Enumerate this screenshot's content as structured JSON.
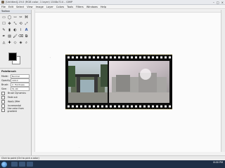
{
  "window": {
    "title": "[Untitled]-19.0 (RGB color, 1 layer) 1348x714 – GIMP",
    "controls": [
      "–",
      "□",
      "×"
    ]
  },
  "menu": [
    "File",
    "Edit",
    "Select",
    "View",
    "Image",
    "Layer",
    "Colors",
    "Tools",
    "Filters",
    "Windows",
    "Help"
  ],
  "toolbox": {
    "header": "Toolbox",
    "tools": [
      "▭",
      "◯",
      "ꟷ",
      "✂",
      "⌘",
      "☐",
      "✥",
      "⤡",
      "⟲",
      "⤢",
      "✎",
      "▮",
      "◐",
      "⌇",
      "A",
      "✒",
      "▨",
      "🖌",
      "⌫",
      "⧉",
      "◬",
      "✚",
      "◇",
      "◈",
      "⌕"
    ],
    "options": {
      "heading": "Paintbrush",
      "mode_label": "Mode:",
      "mode_value": "Normal",
      "opacity_label": "Opacity:",
      "opacity_value": "100.0",
      "brush_label": "Brush:",
      "brush_value": "2. Hardness 100",
      "size_label": "Size:",
      "size_value": "51.00",
      "checkboxes": [
        "Brush Dynamics",
        "Fade out",
        "Apply Jitter",
        "Incremental",
        "Use color from gradient"
      ]
    }
  },
  "statusbar": {
    "text": "Click to paint (Ctrl to pick a color)"
  },
  "taskbar": {
    "time": "8:00 PM"
  }
}
